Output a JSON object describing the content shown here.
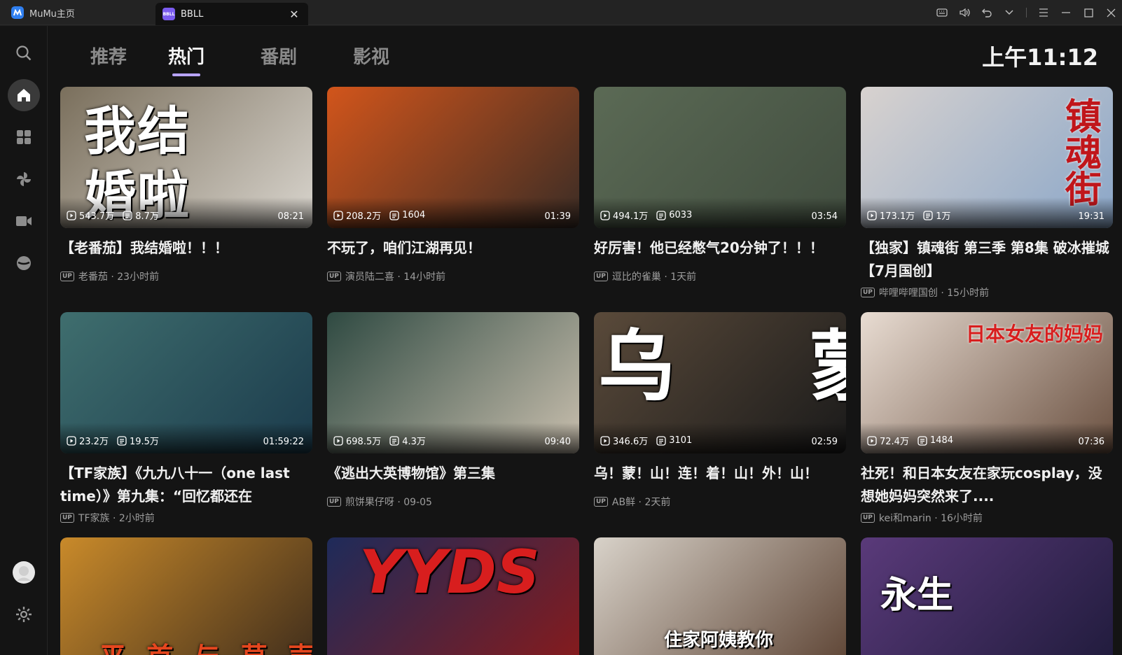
{
  "titlebar": {
    "home_tab": "MuMu主页",
    "app_tab": "BBLL",
    "app_icon_text": "BBLL"
  },
  "nav": {
    "tabs": [
      "推荐",
      "热门",
      "番剧",
      "影视"
    ],
    "active_index": 1
  },
  "clock": "上午11:12",
  "videos": [
    {
      "title": "【老番茄】我结婚啦！！！",
      "views": "543.7万",
      "danmaku": "8.7万",
      "duration": "08:21",
      "uploader": "老番茄 · 23小时前",
      "thumb_text": "我结\n婚啦",
      "colors": [
        "#7a6f5c",
        "#d9d5ce"
      ]
    },
    {
      "title": "不玩了，咱们江湖再见！",
      "views": "208.2万",
      "danmaku": "1604",
      "duration": "01:39",
      "uploader": "演员陆二喜 · 14小时前",
      "thumb_text": "",
      "colors": [
        "#d2551b",
        "#3a2c25"
      ]
    },
    {
      "title": "好厉害！他已经憋气20分钟了！！！",
      "views": "494.1万",
      "danmaku": "6033",
      "duration": "03:54",
      "uploader": "逗比的雀巢 · 1天前",
      "thumb_text": "",
      "colors": [
        "#5b6a55",
        "#414d3f"
      ]
    },
    {
      "title": "【独家】镇魂街 第三季 第8集 破冰摧城【7月国创】",
      "views": "173.1万",
      "danmaku": "1万",
      "duration": "19:31",
      "uploader": "哔哩哔哩国创 · 15小时前",
      "thumb_text": "镇\n魂\n街",
      "colors": [
        "#d8d2cf",
        "#8aa6c8"
      ]
    },
    {
      "title": "【TF家族】《九九八十一（one last time）》第九集：“回忆都还在",
      "views": "23.2万",
      "danmaku": "19.5万",
      "duration": "01:59:22",
      "uploader": "TF家族 · 2小时前",
      "thumb_text": "",
      "colors": [
        "#3f6e6e",
        "#1b3b4c"
      ]
    },
    {
      "title": "《逃出大英博物馆》第三集",
      "views": "698.5万",
      "danmaku": "4.3万",
      "duration": "09:40",
      "uploader": "煎饼果仔呀 · 09-05",
      "thumb_text": "",
      "colors": [
        "#2f4a42",
        "#c9bfae"
      ]
    },
    {
      "title": "乌！蒙！山！连！着！山！外！山！",
      "views": "346.6万",
      "danmaku": "3101",
      "duration": "02:59",
      "uploader": "AB鲜 · 2天前",
      "thumb_text": "乌     蒙",
      "colors": [
        "#5a4a3a",
        "#1a1a1a"
      ]
    },
    {
      "title": "社死！和日本女友在家玩cosplay，没想她妈妈突然来了....",
      "views": "72.4万",
      "danmaku": "1484",
      "duration": "07:36",
      "uploader": "kei和marin · 16小时前",
      "thumb_text": "日本女友的妈妈",
      "colors": [
        "#e8dcd2",
        "#6a5040"
      ]
    },
    {
      "title": "",
      "views": "",
      "danmaku": "",
      "duration": "",
      "uploader": "",
      "thumb_text": "平 首 与 草 声",
      "colors": [
        "#c98a2a",
        "#3b2a1b"
      ]
    },
    {
      "title": "",
      "views": "",
      "danmaku": "",
      "duration": "",
      "uploader": "",
      "thumb_text": "YYDS",
      "colors": [
        "#1e2b5a",
        "#8a1a1a"
      ]
    },
    {
      "title": "",
      "views": "",
      "danmaku": "",
      "duration": "",
      "uploader": "",
      "thumb_text": "住家阿姨教你",
      "colors": [
        "#d8d2c9",
        "#5a4030"
      ]
    },
    {
      "title": "",
      "views": "",
      "danmaku": "",
      "duration": "",
      "uploader": "",
      "thumb_text": "永生",
      "colors": [
        "#5a3a7a",
        "#1e1a3a"
      ]
    }
  ]
}
